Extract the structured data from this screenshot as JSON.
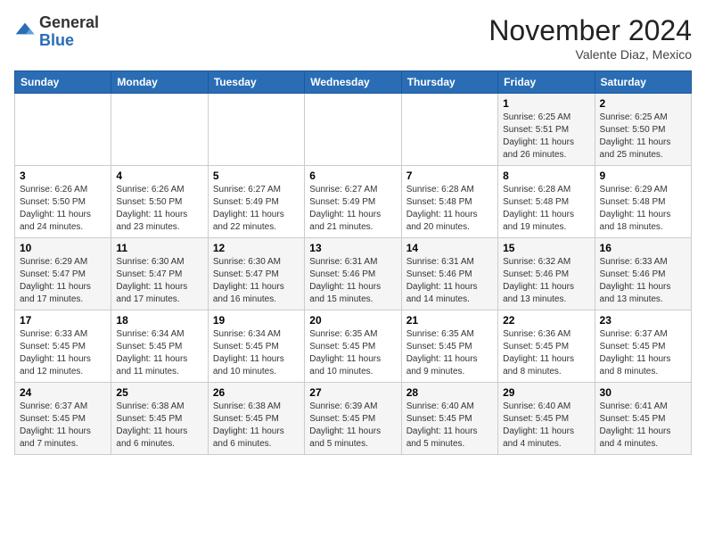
{
  "header": {
    "logo_line1": "General",
    "logo_line2": "Blue",
    "month": "November 2024",
    "location": "Valente Diaz, Mexico"
  },
  "weekdays": [
    "Sunday",
    "Monday",
    "Tuesday",
    "Wednesday",
    "Thursday",
    "Friday",
    "Saturday"
  ],
  "weeks": [
    [
      {
        "day": "",
        "info": ""
      },
      {
        "day": "",
        "info": ""
      },
      {
        "day": "",
        "info": ""
      },
      {
        "day": "",
        "info": ""
      },
      {
        "day": "",
        "info": ""
      },
      {
        "day": "1",
        "info": "Sunrise: 6:25 AM\nSunset: 5:51 PM\nDaylight: 11 hours and 26 minutes."
      },
      {
        "day": "2",
        "info": "Sunrise: 6:25 AM\nSunset: 5:50 PM\nDaylight: 11 hours and 25 minutes."
      }
    ],
    [
      {
        "day": "3",
        "info": "Sunrise: 6:26 AM\nSunset: 5:50 PM\nDaylight: 11 hours and 24 minutes."
      },
      {
        "day": "4",
        "info": "Sunrise: 6:26 AM\nSunset: 5:50 PM\nDaylight: 11 hours and 23 minutes."
      },
      {
        "day": "5",
        "info": "Sunrise: 6:27 AM\nSunset: 5:49 PM\nDaylight: 11 hours and 22 minutes."
      },
      {
        "day": "6",
        "info": "Sunrise: 6:27 AM\nSunset: 5:49 PM\nDaylight: 11 hours and 21 minutes."
      },
      {
        "day": "7",
        "info": "Sunrise: 6:28 AM\nSunset: 5:48 PM\nDaylight: 11 hours and 20 minutes."
      },
      {
        "day": "8",
        "info": "Sunrise: 6:28 AM\nSunset: 5:48 PM\nDaylight: 11 hours and 19 minutes."
      },
      {
        "day": "9",
        "info": "Sunrise: 6:29 AM\nSunset: 5:48 PM\nDaylight: 11 hours and 18 minutes."
      }
    ],
    [
      {
        "day": "10",
        "info": "Sunrise: 6:29 AM\nSunset: 5:47 PM\nDaylight: 11 hours and 17 minutes."
      },
      {
        "day": "11",
        "info": "Sunrise: 6:30 AM\nSunset: 5:47 PM\nDaylight: 11 hours and 17 minutes."
      },
      {
        "day": "12",
        "info": "Sunrise: 6:30 AM\nSunset: 5:47 PM\nDaylight: 11 hours and 16 minutes."
      },
      {
        "day": "13",
        "info": "Sunrise: 6:31 AM\nSunset: 5:46 PM\nDaylight: 11 hours and 15 minutes."
      },
      {
        "day": "14",
        "info": "Sunrise: 6:31 AM\nSunset: 5:46 PM\nDaylight: 11 hours and 14 minutes."
      },
      {
        "day": "15",
        "info": "Sunrise: 6:32 AM\nSunset: 5:46 PM\nDaylight: 11 hours and 13 minutes."
      },
      {
        "day": "16",
        "info": "Sunrise: 6:33 AM\nSunset: 5:46 PM\nDaylight: 11 hours and 13 minutes."
      }
    ],
    [
      {
        "day": "17",
        "info": "Sunrise: 6:33 AM\nSunset: 5:45 PM\nDaylight: 11 hours and 12 minutes."
      },
      {
        "day": "18",
        "info": "Sunrise: 6:34 AM\nSunset: 5:45 PM\nDaylight: 11 hours and 11 minutes."
      },
      {
        "day": "19",
        "info": "Sunrise: 6:34 AM\nSunset: 5:45 PM\nDaylight: 11 hours and 10 minutes."
      },
      {
        "day": "20",
        "info": "Sunrise: 6:35 AM\nSunset: 5:45 PM\nDaylight: 11 hours and 10 minutes."
      },
      {
        "day": "21",
        "info": "Sunrise: 6:35 AM\nSunset: 5:45 PM\nDaylight: 11 hours and 9 minutes."
      },
      {
        "day": "22",
        "info": "Sunrise: 6:36 AM\nSunset: 5:45 PM\nDaylight: 11 hours and 8 minutes."
      },
      {
        "day": "23",
        "info": "Sunrise: 6:37 AM\nSunset: 5:45 PM\nDaylight: 11 hours and 8 minutes."
      }
    ],
    [
      {
        "day": "24",
        "info": "Sunrise: 6:37 AM\nSunset: 5:45 PM\nDaylight: 11 hours and 7 minutes."
      },
      {
        "day": "25",
        "info": "Sunrise: 6:38 AM\nSunset: 5:45 PM\nDaylight: 11 hours and 6 minutes."
      },
      {
        "day": "26",
        "info": "Sunrise: 6:38 AM\nSunset: 5:45 PM\nDaylight: 11 hours and 6 minutes."
      },
      {
        "day": "27",
        "info": "Sunrise: 6:39 AM\nSunset: 5:45 PM\nDaylight: 11 hours and 5 minutes."
      },
      {
        "day": "28",
        "info": "Sunrise: 6:40 AM\nSunset: 5:45 PM\nDaylight: 11 hours and 5 minutes."
      },
      {
        "day": "29",
        "info": "Sunrise: 6:40 AM\nSunset: 5:45 PM\nDaylight: 11 hours and 4 minutes."
      },
      {
        "day": "30",
        "info": "Sunrise: 6:41 AM\nSunset: 5:45 PM\nDaylight: 11 hours and 4 minutes."
      }
    ]
  ]
}
